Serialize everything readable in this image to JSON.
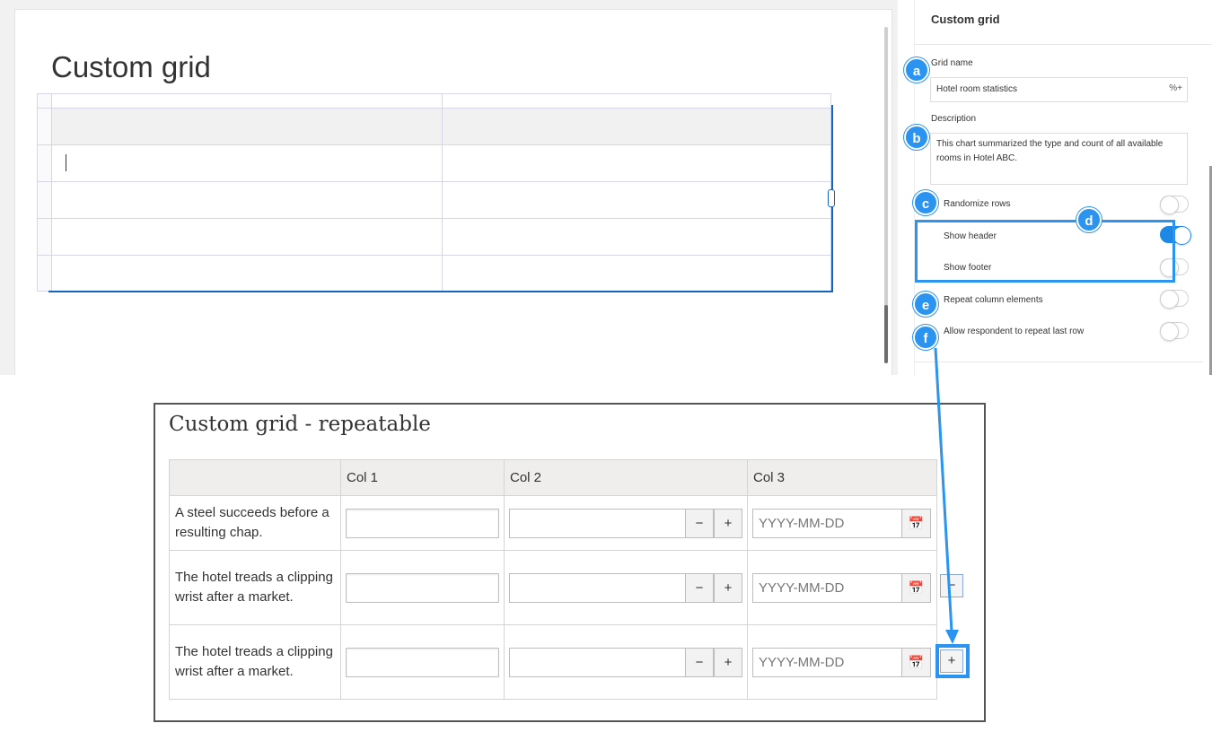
{
  "editor": {
    "title": "Custom grid"
  },
  "panel": {
    "title": "Custom grid",
    "grid_name_label": "Grid name",
    "grid_name_value": "Hotel room statistics",
    "description_label": "Description",
    "description_value": "This chart summarized the type and count of all available rooms in Hotel ABC.",
    "toggles": [
      {
        "label": "Randomize rows",
        "on": false
      },
      {
        "label": "Show header",
        "on": true
      },
      {
        "label": "Show footer",
        "on": false
      },
      {
        "label": "Repeat column elements",
        "on": false
      },
      {
        "label": "Allow respondent to repeat last row",
        "on": false
      }
    ]
  },
  "callouts": [
    "a",
    "b",
    "c",
    "d",
    "e",
    "f"
  ],
  "accent_color": "#2b93f0",
  "preview": {
    "title": "Custom grid - repeatable",
    "columns": [
      "",
      "Col 1",
      "Col 2",
      "Col 3"
    ],
    "rows": [
      {
        "label": "A steel succeeds before a resulting chap."
      },
      {
        "label": "The hotel treads a clipping wrist after a market."
      },
      {
        "label": "The hotel treads a clipping wrist after a market."
      }
    ],
    "date_placeholder": "YYYY-MM-DD",
    "minus_label": "−",
    "plus_label": "+",
    "remove_row_label": "−",
    "add_row_label": "+"
  }
}
